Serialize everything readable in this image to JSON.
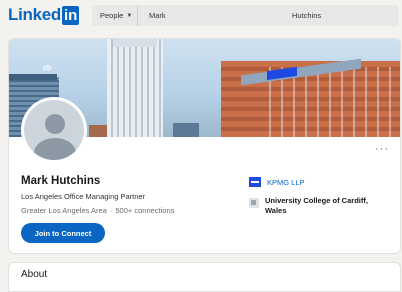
{
  "brand": {
    "logo_word": "Linked",
    "logo_box": "in",
    "color": "#0a66c2"
  },
  "search": {
    "type_label": "People",
    "first_name": "Mark",
    "last_name": "Hutchins"
  },
  "profile": {
    "name": "Mark Hutchins",
    "headline": "Los Angeles Office Managing Partner",
    "location": "Greater Los Angeles Area",
    "separator": "·",
    "connections": "500+ connections",
    "join_button": "Join to Connect",
    "more_label": "···"
  },
  "experience": {
    "company": "KPMG LLP",
    "school": "University College of Cardiff, Wales"
  },
  "cover": {
    "sign_text": "cb"
  },
  "about": {
    "title": "About"
  },
  "icons": [
    "caret-down-icon",
    "more-icon",
    "company-logo-icon",
    "school-logo-icon",
    "avatar-placeholder-icon"
  ]
}
